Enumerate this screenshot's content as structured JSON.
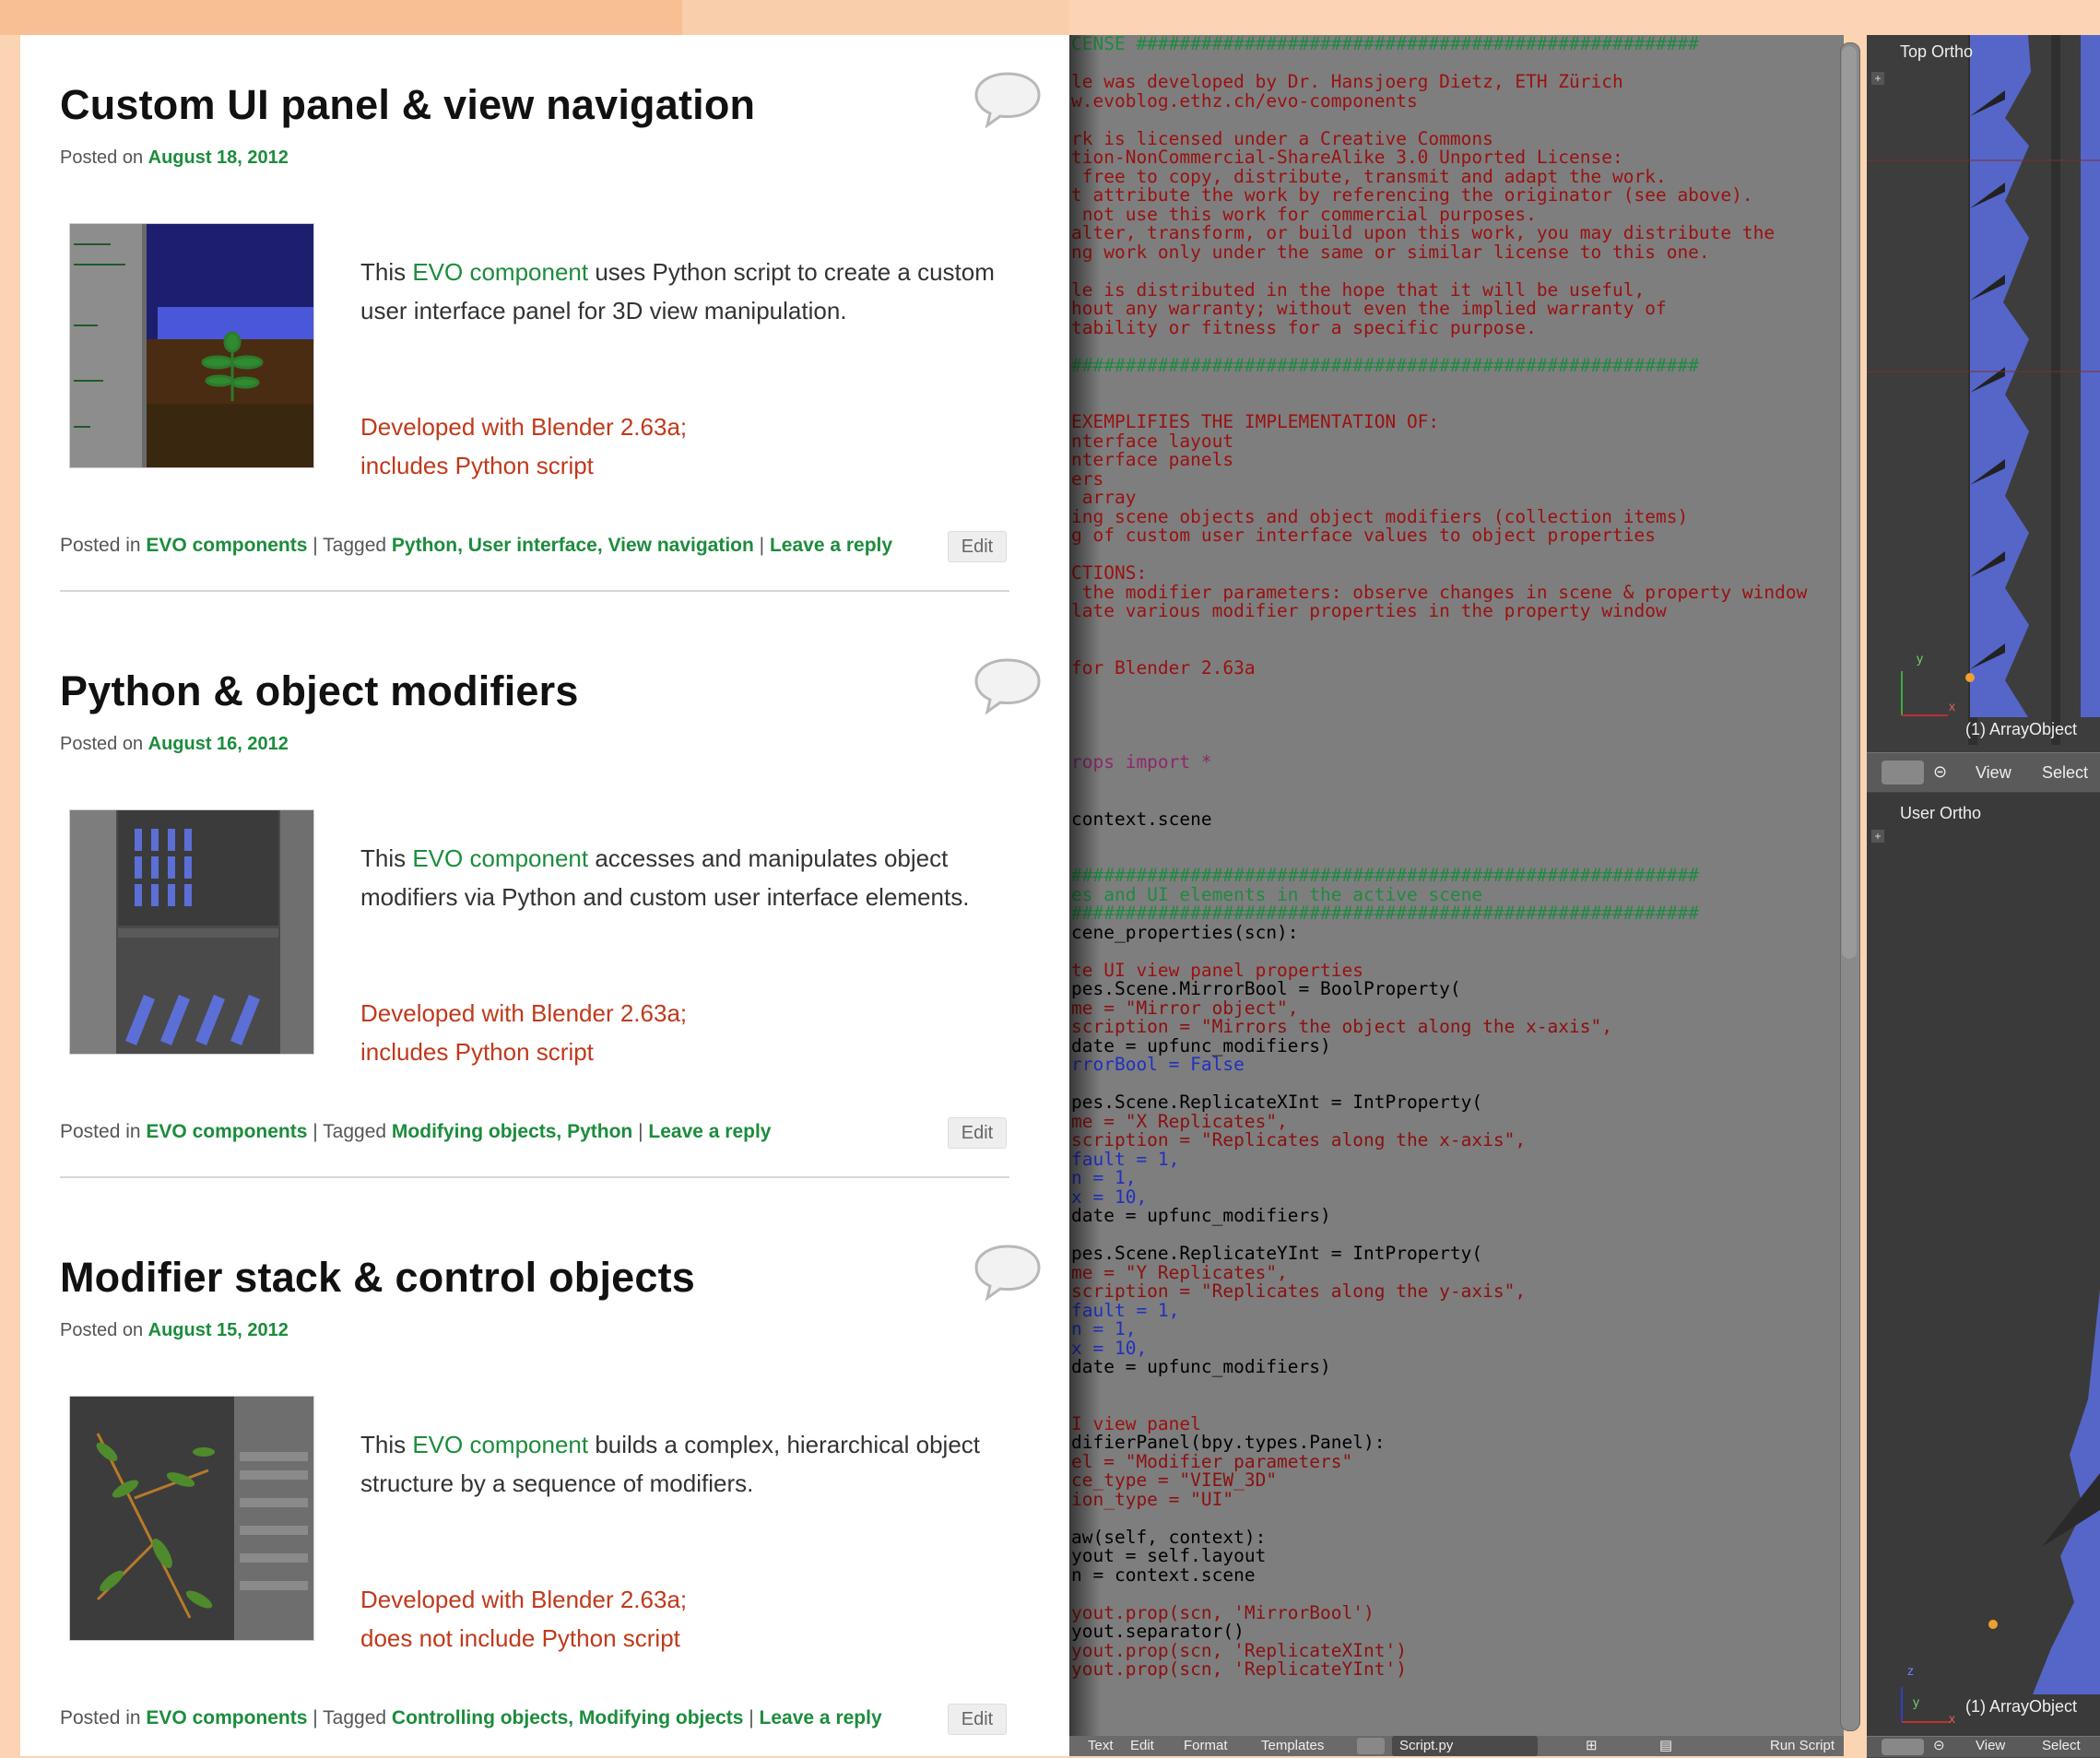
{
  "posts": [
    {
      "title": "Custom UI panel & view navigation",
      "posted_prefix": "Posted on ",
      "date": "August 18, 2012",
      "desc_pre": "This ",
      "desc_link": "EVO component",
      "desc_post": " uses Python script to create a custom user interface panel for 3D view manipulation.",
      "dev_line1": "Developed with Blender 2.63a;",
      "dev_line2": "includes Python script",
      "meta_posted_in": "Posted in ",
      "category": "EVO components",
      "meta_tagged": " | Tagged ",
      "tags": [
        "Python",
        "User interface",
        "View navigation"
      ],
      "meta_sep": " | ",
      "reply": "Leave a reply",
      "edit": "Edit"
    },
    {
      "title": "Python & object modifiers",
      "posted_prefix": "Posted on ",
      "date": "August 16, 2012",
      "desc_pre": "This ",
      "desc_link": "EVO component",
      "desc_post": " accesses and manipulates object modifiers via Python and custom user interface elements.",
      "dev_line1": "Developed with Blender 2.63a;",
      "dev_line2": "includes Python script",
      "meta_posted_in": "Posted in ",
      "category": "EVO components",
      "meta_tagged": " | Tagged ",
      "tags": [
        "Modifying objects",
        "Python"
      ],
      "meta_sep": " | ",
      "reply": "Leave a reply",
      "edit": "Edit"
    },
    {
      "title": "Modifier stack & control objects",
      "posted_prefix": "Posted on ",
      "date": "August 15, 2012",
      "desc_pre": "This ",
      "desc_link": "EVO component",
      "desc_post": " builds a complex, hierarchical object structure by a sequence of modifiers.",
      "dev_line1": "Developed with Blender 2.63a;",
      "dev_line2": "does not include Python script",
      "meta_posted_in": "Posted in ",
      "category": "EVO components",
      "meta_tagged": " | Tagged ",
      "tags": [
        "Controlling objects",
        "Modifying objects"
      ],
      "meta_sep": " | ",
      "reply": "Leave a reply",
      "edit": "Edit"
    }
  ],
  "code_lines": [
    [
      "hash",
      "CENSE ####################################################"
    ],
    [
      "",
      ""
    ],
    [
      "cmt",
      "le was developed by Dr. Hansjoerg Dietz, ETH Zürich"
    ],
    [
      "cmt",
      "w.evoblog.ethz.ch/evo-components"
    ],
    [
      "",
      ""
    ],
    [
      "cmt",
      "rk is licensed under a Creative Commons"
    ],
    [
      "cmt",
      "tion-NonCommercial-ShareAlike 3.0 Unported License:"
    ],
    [
      "cmt",
      " free to copy, distribute, transmit and adapt the work."
    ],
    [
      "cmt",
      "t attribute the work by referencing the originator (see above)."
    ],
    [
      "cmt",
      " not use this work for commercial purposes."
    ],
    [
      "cmt",
      "alter, transform, or build upon this work, you may distribute the"
    ],
    [
      "cmt",
      "ng work only under the same or similar license to this one."
    ],
    [
      "",
      ""
    ],
    [
      "cmt",
      "le is distributed in the hope that it will be useful,"
    ],
    [
      "cmt",
      "hout any warranty; without even the implied warranty of"
    ],
    [
      "cmt",
      "tability or fitness for a specific purpose."
    ],
    [
      "",
      ""
    ],
    [
      "hash",
      "##########################################################"
    ],
    [
      "",
      ""
    ],
    [
      "",
      ""
    ],
    [
      "cmt",
      "EXEMPLIFIES THE IMPLEMENTATION OF:"
    ],
    [
      "cmt",
      "nterface layout"
    ],
    [
      "cmt",
      "nterface panels"
    ],
    [
      "cmt",
      "ers"
    ],
    [
      "cmt",
      " array"
    ],
    [
      "cmt",
      "ing scene objects and object modifiers (collection items)"
    ],
    [
      "cmt",
      "g of custom user interface values to object properties"
    ],
    [
      "",
      ""
    ],
    [
      "cmt",
      "CTIONS:"
    ],
    [
      "cmt",
      " the modifier parameters: observe changes in scene & property window"
    ],
    [
      "cmt",
      "late various modifier properties in the property window"
    ],
    [
      "",
      ""
    ],
    [
      "",
      ""
    ],
    [
      "cmt",
      "for Blender 2.63a"
    ],
    [
      "",
      ""
    ],
    [
      "",
      ""
    ],
    [
      "",
      ""
    ],
    [
      "",
      ""
    ],
    [
      "kw",
      "rops import *"
    ],
    [
      "",
      ""
    ],
    [
      "",
      ""
    ],
    [
      "",
      "context.scene"
    ],
    [
      "",
      ""
    ],
    [
      "",
      ""
    ],
    [
      "hash",
      "##########################################################"
    ],
    [
      "hash",
      "es and UI elements in the active scene"
    ],
    [
      "hash",
      "##########################################################"
    ],
    [
      "",
      "cene_properties(scn):"
    ],
    [
      "",
      ""
    ],
    [
      "cmt",
      "te UI view panel properties"
    ],
    [
      "",
      "pes.Scene.MirrorBool = BoolProperty("
    ],
    [
      "str",
      "me = \"Mirror object\","
    ],
    [
      "str",
      "scription = \"Mirrors the object along the x-axis\","
    ],
    [
      "",
      "date = upfunc_modifiers)"
    ],
    [
      "num",
      "rrorBool = False"
    ],
    [
      "",
      ""
    ],
    [
      "",
      "pes.Scene.ReplicateXInt = IntProperty("
    ],
    [
      "str",
      "me = \"X Replicates\","
    ],
    [
      "str",
      "scription = \"Replicates along the x-axis\","
    ],
    [
      "num",
      "fault = 1,"
    ],
    [
      "num",
      "n = 1,"
    ],
    [
      "num",
      "x = 10,"
    ],
    [
      "",
      "date = upfunc_modifiers)"
    ],
    [
      "",
      ""
    ],
    [
      "",
      "pes.Scene.ReplicateYInt = IntProperty("
    ],
    [
      "str",
      "me = \"Y Replicates\","
    ],
    [
      "str",
      "scription = \"Replicates along the y-axis\","
    ],
    [
      "num",
      "fault = 1,"
    ],
    [
      "num",
      "n = 1,"
    ],
    [
      "num",
      "x = 10,"
    ],
    [
      "",
      "date = upfunc_modifiers)"
    ],
    [
      "",
      ""
    ],
    [
      "",
      ""
    ],
    [
      "cmt",
      "I view panel"
    ],
    [
      "",
      "difierPanel(bpy.types.Panel):"
    ],
    [
      "str",
      "el = \"Modifier parameters\""
    ],
    [
      "str",
      "ce_type = \"VIEW_3D\""
    ],
    [
      "str",
      "ion_type = \"UI\""
    ],
    [
      "",
      ""
    ],
    [
      "",
      "aw(self, context):"
    ],
    [
      "",
      "yout = self.layout"
    ],
    [
      "",
      "n = context.scene"
    ],
    [
      "",
      ""
    ],
    [
      "str",
      "yout.prop(scn, 'MirrorBool')"
    ],
    [
      "",
      "yout.separator()"
    ],
    [
      "str",
      "yout.prop(scn, 'ReplicateXInt')"
    ],
    [
      "str",
      "yout.prop(scn, 'ReplicateYInt')"
    ],
    [
      "",
      ""
    ],
    [
      "",
      ""
    ],
    [
      "",
      ""
    ],
    [
      "",
      ""
    ],
    [
      "hash",
      "##########################################################"
    ]
  ],
  "code_footer": {
    "menu_text": "Text",
    "menu_edit": "Edit",
    "menu_format": "Format",
    "menu_templates": "Templates",
    "script_name": "Script.py",
    "run_script": "Run Script"
  },
  "viewport": {
    "top_label": "Top Ortho",
    "user_label": "User Ortho",
    "object_label": "(1) ArrayObject",
    "menu_view": "View",
    "menu_select": "Select",
    "axis_x": "x",
    "axis_y": "y",
    "axis_z": "z"
  },
  "colors": {
    "link_green": "#1c8c3c",
    "dev_red": "#c0391b",
    "page_peach": "#fbd5b3",
    "mesh_blue": "#5566c8"
  }
}
